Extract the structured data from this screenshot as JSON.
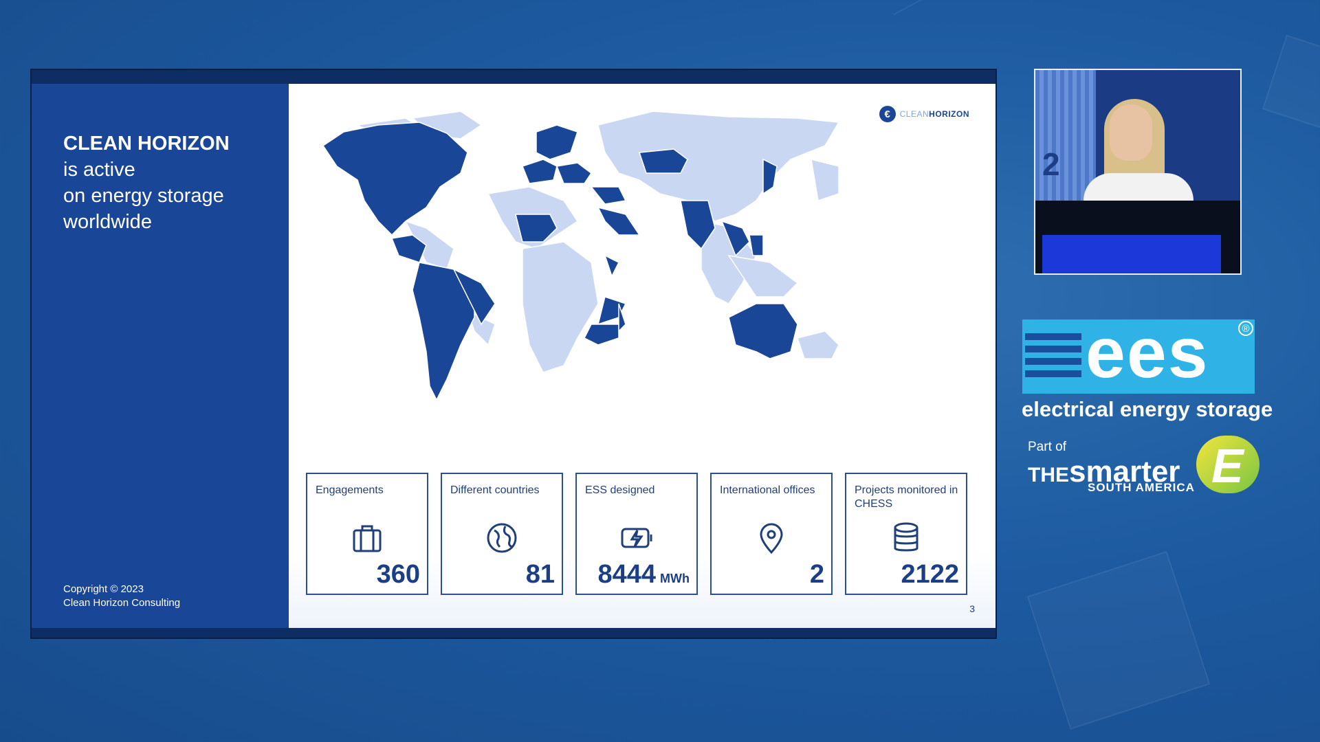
{
  "slide": {
    "title_bold": "CLEAN HORIZON",
    "title_lines": [
      "is active",
      "on energy storage",
      "worldwide"
    ],
    "copyright": [
      "Copyright © 2023",
      "Clean Horizon Consulting"
    ],
    "logo": {
      "thin": "CLEAN",
      "strong": "HORIZON"
    },
    "page_number": "3",
    "stats": [
      {
        "label": "Engagements",
        "icon": "briefcase-icon",
        "value": "360",
        "unit": ""
      },
      {
        "label": "Different countries",
        "icon": "globe-icon",
        "value": "81",
        "unit": ""
      },
      {
        "label": "ESS designed",
        "icon": "battery-bolt-icon",
        "value": "8444",
        "unit": "MWh"
      },
      {
        "label": "International offices",
        "icon": "map-pin-icon",
        "value": "2",
        "unit": ""
      },
      {
        "label": "Projects monitored in CHESS",
        "icon": "database-icon",
        "value": "2122",
        "unit": ""
      }
    ],
    "colors": {
      "active": "#1a4697",
      "inactive": "#c9d7f2"
    }
  },
  "video": {
    "background_number": "2"
  },
  "branding": {
    "ees": "ees",
    "tagline": "electrical energy storage",
    "part_of": "Part of",
    "the": "THE",
    "smarter": "smarter",
    "region": "SOUTH AMERICA",
    "e_badge": "E"
  }
}
